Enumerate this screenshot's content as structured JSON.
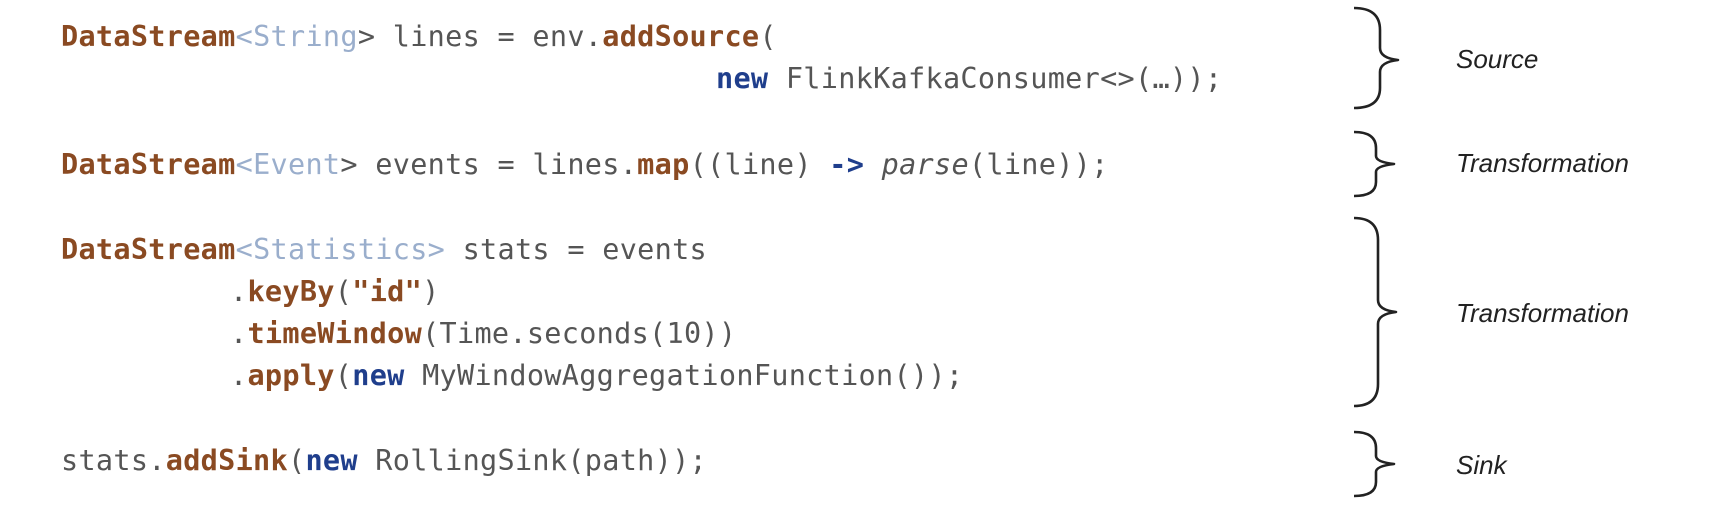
{
  "code": {
    "line1": {
      "type": "DataStream",
      "lt": "<",
      "generic": "String",
      "gt": ">",
      "mid": " lines = env.",
      "method": "addSource",
      "end": "("
    },
    "line2": {
      "new_kw": "new",
      "rest": " FlinkKafkaConsumer<>(…));"
    },
    "line3": {
      "type": "DataStream",
      "lt": "<",
      "generic": "Event",
      "gt": ">",
      "mid": " events = lines.",
      "method": "map",
      "p1": "((line) ",
      "arrow": "->",
      "sp": " ",
      "fn": "parse",
      "end": "(line));"
    },
    "line4": {
      "type": "DataStream",
      "lt": "<",
      "generic": "Statistics",
      "gt": ">",
      "rest": " stats = events"
    },
    "line5": {
      "dot": ".",
      "method": "keyBy",
      "p1": "(",
      "str": "\"id\"",
      "p2": ")"
    },
    "line6": {
      "dot": ".",
      "method": "timeWindow",
      "rest": "(Time.seconds(10))"
    },
    "line7": {
      "dot": ".",
      "method": "apply",
      "p1": "(",
      "new_kw": "new",
      "rest": " MyWindowAggregationFunction());"
    },
    "line8": {
      "obj": "stats.",
      "method": "addSink",
      "p1": "(",
      "new_kw": "new",
      "rest": " RollingSink(path));"
    }
  },
  "annotations": {
    "source": "Source",
    "transformation1": "Transformation",
    "transformation2": "Transformation",
    "sink": "Sink"
  }
}
